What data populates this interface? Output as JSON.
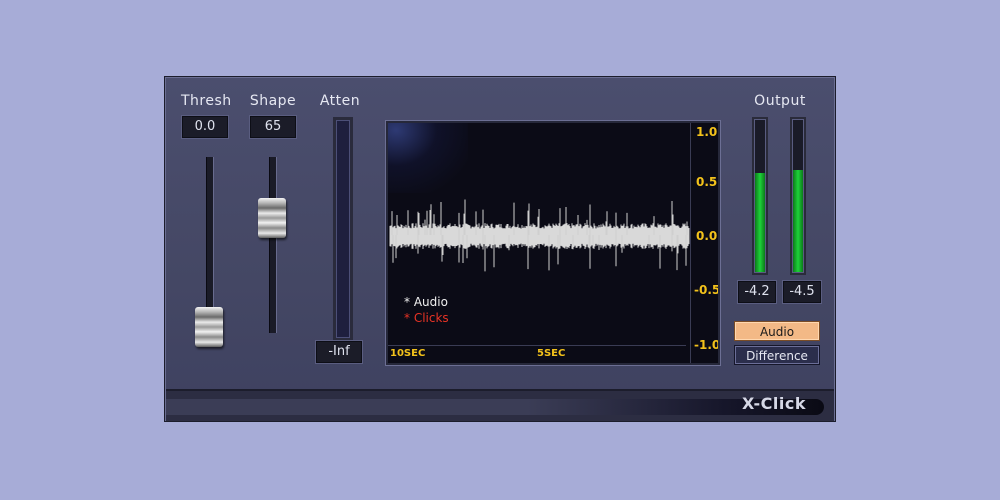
{
  "plugin": {
    "name": "X-Click",
    "colors": {
      "panel": "#474a68",
      "accent": "#f3c21b",
      "meter": "#1ed33a",
      "clicks": "#e83325"
    }
  },
  "thresh": {
    "label": "Thresh",
    "value": "0.0",
    "slider_level": 0.15
  },
  "shape": {
    "label": "Shape",
    "value": "65",
    "slider_level": 0.65
  },
  "atten": {
    "label": "Atten",
    "value": "-Inf"
  },
  "display": {
    "y_ticks": [
      "1.0",
      "0.5",
      "0.0",
      "-0.5",
      "-1.0"
    ],
    "x_ticks": [
      "10SEC",
      "5SEC"
    ],
    "legend_audio": "* Audio",
    "legend_clicks": "* Clicks"
  },
  "output": {
    "label": "Output",
    "left_value": "-4.2",
    "right_value": "-4.5",
    "left_level": 0.66,
    "right_level": 0.68
  },
  "buttons": {
    "audio": "Audio",
    "difference": "Difference",
    "selected": "Audio"
  }
}
